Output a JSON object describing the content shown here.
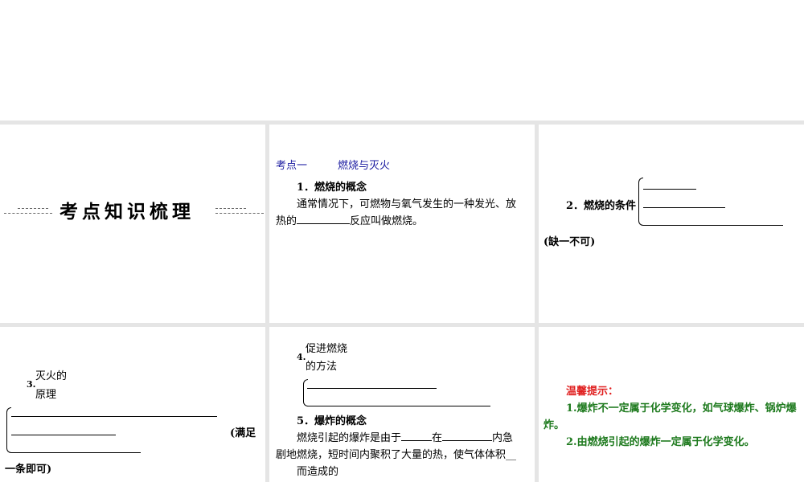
{
  "p1": {
    "title": "考点知识梳理"
  },
  "p2": {
    "heading_a": "考点一",
    "heading_b": "燃烧与灭火",
    "item1": "1．燃烧的概念",
    "line1": "通常情况下，可燃物与氧气发生的一种发光、放",
    "line2_a": "热的",
    "line2_b": "反应叫做燃烧。"
  },
  "p3": {
    "item2": "2．燃烧的条件",
    "note": "(缺一不可)"
  },
  "p4": {
    "num": "3.",
    "label_a": "灭火的",
    "label_b": "原理",
    "note_a": "(满足",
    "note_b": "一条即可)"
  },
  "p5": {
    "num": "4.",
    "label_a": "促进燃烧",
    "label_b": "的方法",
    "item5": "5．爆炸的概念",
    "s1_a": "燃烧引起的爆炸是由于",
    "s1_b": "在",
    "s1_c": "内急",
    "s2": "剧地燃烧，短时间内聚积了大量的热，使气体体积__",
    "s3": "而造成的"
  },
  "p6": {
    "tip_title": "温馨提示：",
    "tip1_a": "1.爆炸不一定属于化学变化，如气球爆炸、锅炉爆",
    "tip1_b": "炸。",
    "tip2": "2.由燃烧引起的爆炸一定属于化学变化。"
  }
}
